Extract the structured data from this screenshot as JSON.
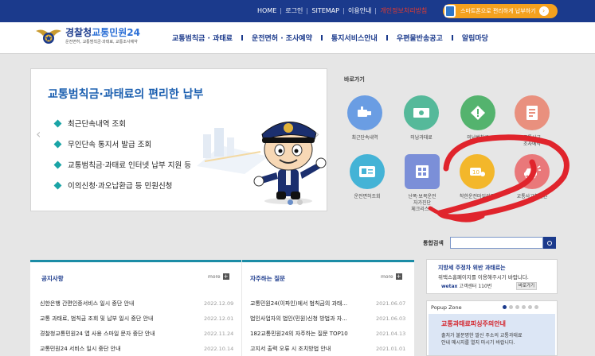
{
  "colors": {
    "primary": "#1b3a8c",
    "accent": "#2b6fd6",
    "teal": "#1aa4a6",
    "orange": "#f4a11e",
    "annotation": "#e0242c"
  },
  "topbar": {
    "links": [
      {
        "label": "HOME"
      },
      {
        "label": "로그인"
      },
      {
        "label": "SITEMAP"
      },
      {
        "label": "이용안내"
      },
      {
        "label": "개인정보처리방침",
        "highlight": true
      }
    ],
    "app_button": "스마트폰으로 편리하게 납부하기"
  },
  "header": {
    "logo_title_a": "경찰청",
    "logo_title_b": "교통민원24",
    "logo_subtitle": "운전면허, 교통범칙금·과태료, 교통조사예약",
    "nav": [
      "교통범칙금 · 과태료",
      "운전면허 · 조사예약",
      "통지서비스안내",
      "우편물반송공고",
      "알림마당"
    ]
  },
  "banner": {
    "title": "교통범칙금·과태료의 편리한 납부",
    "items": [
      "최근단속내역 조회",
      "무인단속 통지서 발급 조회",
      "교통범칙금·과태료 인터넷 납부 지원 등",
      "이의신청·과오납환급 등 민원신청"
    ],
    "prev_arrow": "‹",
    "next_arrow": "›",
    "active_slide": 0,
    "slide_count": 2
  },
  "shortcuts": {
    "title": "바로가기",
    "items": [
      {
        "label": "최근단속내역",
        "icon": "camera-icon",
        "color": "#6a9de3"
      },
      {
        "label": "미납과태료",
        "icon": "banknote-icon",
        "color": "#55b99a"
      },
      {
        "label": "미납범칙금",
        "icon": "warning-diamond-icon",
        "color": "#54b36e"
      },
      {
        "label": "교통사고\n조사예약",
        "icon": "document-icon",
        "color": "#e9907e"
      },
      {
        "label": "운전면허조회",
        "icon": "license-card-icon",
        "color": "#44b3d6"
      },
      {
        "label": "난폭·보복운전\n자가진단\n체크리스트",
        "icon": "checklist-icon",
        "color": "#7b8fd8"
      },
      {
        "label": "착한운전마일리지",
        "icon": "mileage-icon",
        "color": "#f3b72b"
      },
      {
        "label": "교통사고확인원",
        "icon": "car-crash-icon",
        "color": "#e9787a"
      }
    ]
  },
  "search": {
    "label": "통합검색",
    "value": ""
  },
  "notices": {
    "title": "공지사항",
    "more": "more",
    "rows": [
      {
        "title": "신한은행 간편인증서비스 일시 중단 안내",
        "date": "2022.12.09"
      },
      {
        "title": "교통 과태료, 범칙금 조회 및 납부 일시 중단 안내",
        "date": "2022.12.01"
      },
      {
        "title": "경찰청교통민원24 앱 사용 스마일 문자 중단 안내",
        "date": "2022.11.24"
      },
      {
        "title": "교통민원24 서비스 일시 중단 안내",
        "date": "2022.10.14"
      }
    ]
  },
  "faq": {
    "title": "자주하는 질문",
    "more": "more",
    "rows": [
      {
        "title": "교통민원24(이파인)에서 범칙금의 과태...",
        "date": "2021.06.07"
      },
      {
        "title": "법인사업자의 법인(민원)신청 방법과 자...",
        "date": "2021.06.03"
      },
      {
        "title": "182교통민원24의 자주하는 질문 TOP10",
        "date": "2021.04.13"
      },
      {
        "title": "고지서 출력 오류 시 조치방법 안내",
        "date": "2021.01.01"
      }
    ]
  },
  "promo": {
    "line1": "지방세 주정차 위반 과태료는",
    "line2": "위택스홈페이지를 이용해주시기 바랍니다.",
    "brand": "wetax",
    "phone": "고객센터 110번",
    "button": "바로가기"
  },
  "popup": {
    "title": "Popup Zone",
    "slide_count": 6,
    "active_slide": 0,
    "heading": "교통과태료피싱주의안내",
    "line1": "출처가 불분명한 발신 주소의 교통과태료",
    "line2": "안내 메시지를 열지 마시기 바랍니다."
  }
}
